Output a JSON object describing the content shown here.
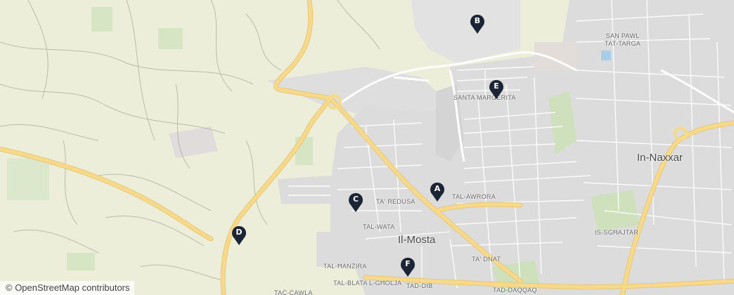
{
  "map": {
    "colors": {
      "land": "#eceed9",
      "urban": "#dcdcdc",
      "road_major": "#f6d98a",
      "road_minor": "#ffffff",
      "park": "#d6e6c4",
      "water": "#a8cde8",
      "marker": "#1b2535"
    },
    "places": [
      {
        "id": "san-pawl-tat-targa",
        "line1": "SAN PAWL",
        "line2": "TAT-TARGA"
      },
      {
        "id": "santa-margerita",
        "text": "SANTA MARGERITA"
      },
      {
        "id": "in-naxxar",
        "text": "In-Naxxar"
      },
      {
        "id": "tal-awrora",
        "text": "TAL-AWRORA"
      },
      {
        "id": "ta-redusa",
        "text": "TA' REDUSA"
      },
      {
        "id": "tal-wata",
        "text": "TAL-WATA"
      },
      {
        "id": "il-mosta",
        "text": "Il-Mosta"
      },
      {
        "id": "is-sghajtar",
        "text": "IS-SGĦAJTAR"
      },
      {
        "id": "ta-dnat",
        "text": "TA' DNAT"
      },
      {
        "id": "tal-hanzira",
        "text": "TAL-ĦANŻIRA"
      },
      {
        "id": "tal-blata-l-gholja",
        "text": "TAL-BLATA L-GĦOLJA"
      },
      {
        "id": "tad-dib",
        "text": "TAD-DIB"
      },
      {
        "id": "tad-daqqaq",
        "text": "TAD-DAQQAQ"
      },
      {
        "id": "tac-cawla",
        "text": "TAĊ-ĊAWLA"
      }
    ],
    "markers": [
      {
        "id": "a",
        "label": "A"
      },
      {
        "id": "b",
        "label": "B"
      },
      {
        "id": "c",
        "label": "C"
      },
      {
        "id": "d",
        "label": "D"
      },
      {
        "id": "e",
        "label": "E"
      },
      {
        "id": "f",
        "label": "F"
      }
    ],
    "attribution": "© OpenStreetMap contributors"
  }
}
